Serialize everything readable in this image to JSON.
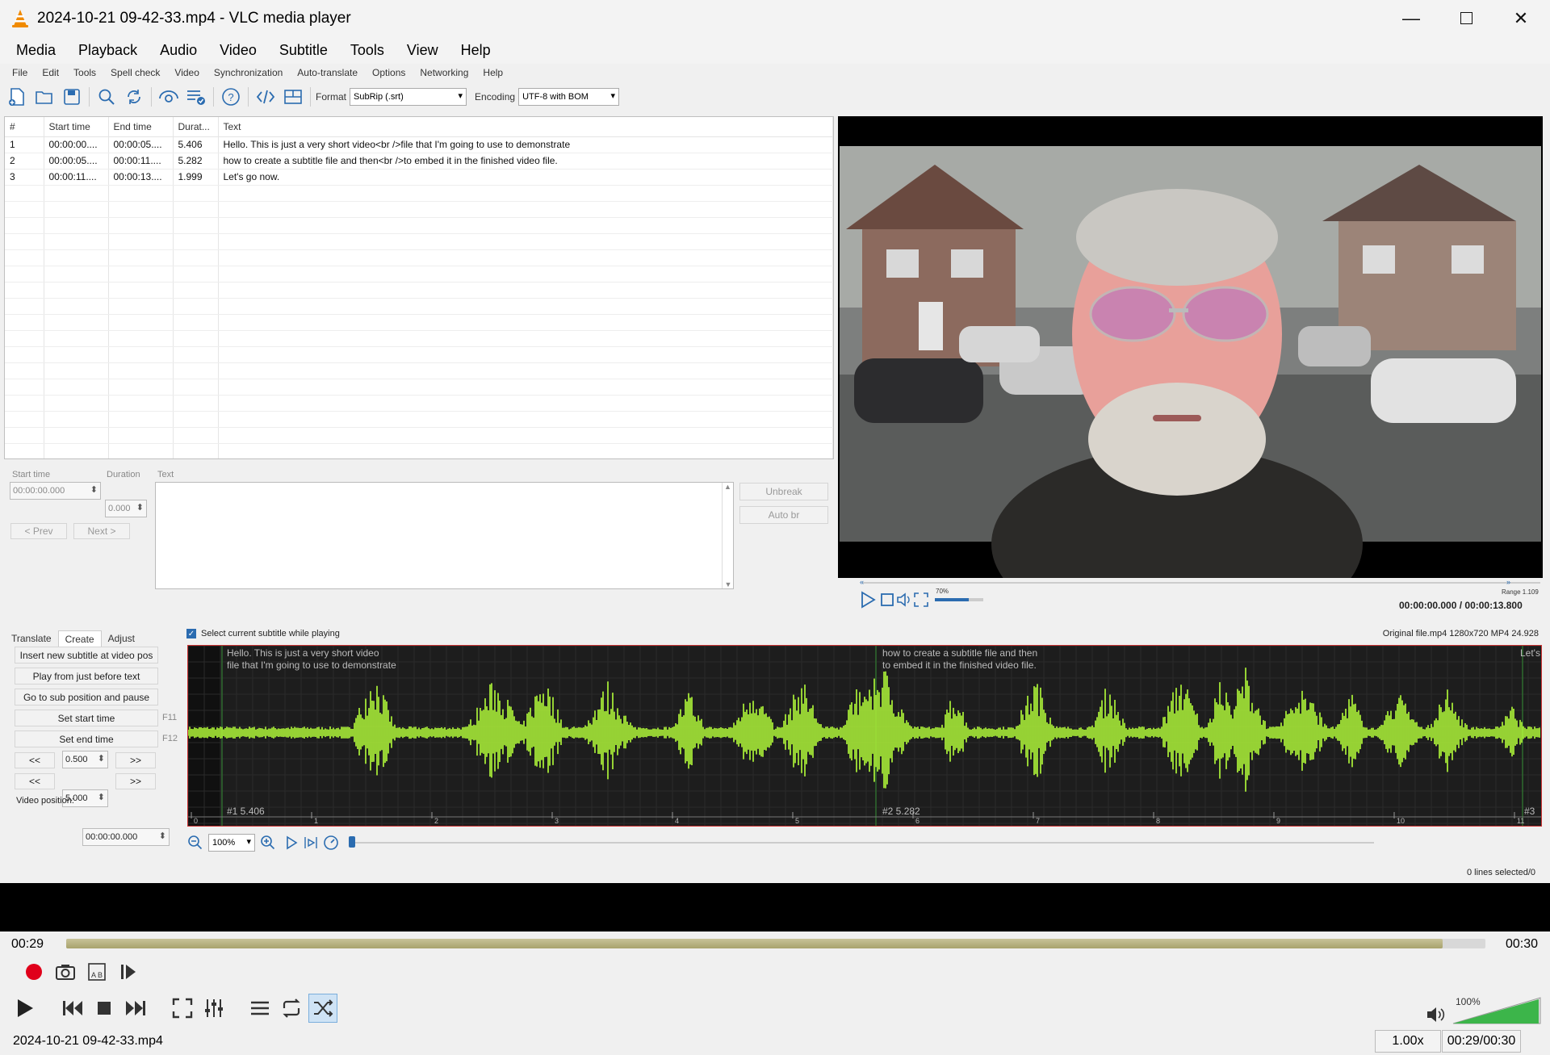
{
  "window": {
    "title": "2024-10-21 09-42-33.mp4 - VLC media player"
  },
  "vlc_menu": [
    "Media",
    "Playback",
    "Audio",
    "Video",
    "Subtitle",
    "Tools",
    "View",
    "Help"
  ],
  "se_menu": [
    "File",
    "Edit",
    "Tools",
    "Spell check",
    "Video",
    "Synchronization",
    "Auto-translate",
    "Options",
    "Networking",
    "Help"
  ],
  "toolbar": {
    "format_label": "Format",
    "format_value": "SubRip (.srt)",
    "encoding_label": "Encoding",
    "encoding_value": "UTF-8 with BOM"
  },
  "grid": {
    "headers": [
      "#",
      "Start time",
      "End time",
      "Durat...",
      "Text"
    ],
    "rows": [
      {
        "n": "1",
        "start": "00:00:00....",
        "end": "00:00:05....",
        "dur": "5.406",
        "text": "Hello. This is just a very short video<br />file that I'm going to use to demonstrate"
      },
      {
        "n": "2",
        "start": "00:00:05....",
        "end": "00:00:11....",
        "dur": "5.282",
        "text": "how to create a subtitle file and then<br />to embed it in the finished video file."
      },
      {
        "n": "3",
        "start": "00:00:11....",
        "end": "00:00:13....",
        "dur": "1.999",
        "text": "Let's go now."
      }
    ]
  },
  "edit": {
    "start_label": "Start time",
    "duration_label": "Duration",
    "text_label": "Text",
    "start_value": "00:00:00.000",
    "duration_value": "0.000",
    "prev": "< Prev",
    "next": "Next >",
    "unbreak": "Unbreak",
    "auto_br": "Auto br"
  },
  "video_player": {
    "time": "00:00:00.000 / 00:00:13.800",
    "volume_pct": "70%",
    "speed": "Range 1.109"
  },
  "tabs": [
    "Translate",
    "Create",
    "Adjust"
  ],
  "select_current": "Select current subtitle while playing",
  "file_info": "Original file.mp4 1280x720 MP4 24.928",
  "create_panel": {
    "insert": "Insert new subtitle at video pos",
    "play_before": "Play from just before text",
    "goto": "Go to sub position and pause",
    "set_start": "Set start time",
    "set_start_key": "F11",
    "set_end": "Set end time",
    "set_end_key": "F12",
    "back": "<<",
    "fwd": ">>",
    "step1": "0.500",
    "step2": "5.000",
    "video_pos_label": "Video position:",
    "video_pos": "00:00:00.000"
  },
  "waveform": {
    "sub1_line1": "Hello. This is just a very short video",
    "sub1_line2": "file that I'm going to use to demonstrate",
    "sub2_line1": "how to create a subtitle file and then",
    "sub2_line2": "to embed it in the finished video file.",
    "sub3": "Let's",
    "mark1": "#1  5.406",
    "mark2": "#2  5.282",
    "mark3": "#3",
    "ticks": [
      "0",
      "1",
      "2",
      "3",
      "4",
      "5",
      "6",
      "7",
      "8",
      "9",
      "10",
      "11"
    ],
    "zoom": "100%"
  },
  "lines_selected": "0 lines selected/0",
  "vlc_controls": {
    "time_elapsed": "00:29",
    "time_total": "00:30",
    "progress": 0.97,
    "filename": "2024-10-21 09-42-33.mp4",
    "speed": "1.00x",
    "time_status": "00:29/00:30",
    "volume": "100%"
  },
  "colors": {
    "waveform": "#b5ff3a",
    "waveform_bg": "#1d1d1d",
    "record": "#e0001a",
    "selection_border": "#c33"
  }
}
